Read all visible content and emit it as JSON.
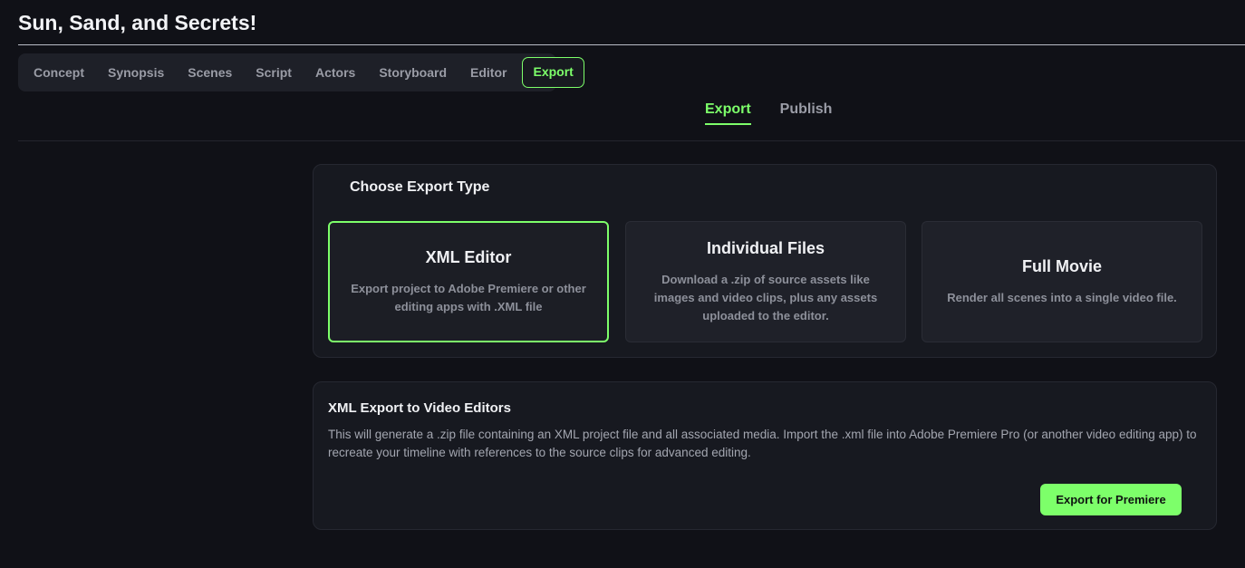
{
  "project": {
    "title": "Sun, Sand, and Secrets!"
  },
  "stepper": {
    "steps": [
      "Concept",
      "Synopsis",
      "Scenes",
      "Script",
      "Actors",
      "Storyboard",
      "Editor",
      "Export"
    ],
    "active": "Export"
  },
  "subtabs": {
    "export_label": "Export",
    "publish_label": "Publish",
    "active": "Export"
  },
  "export_type": {
    "heading": "Choose Export Type",
    "cards": [
      {
        "title": "XML Editor",
        "description": "Export project to Adobe Premiere or other editing apps with .XML file",
        "selected": true
      },
      {
        "title": "Individual Files",
        "description": "Download a .zip of source assets like images and video clips, plus any assets uploaded to the editor.",
        "selected": false
      },
      {
        "title": "Full Movie",
        "description": "Render all scenes into a single video file.",
        "selected": false
      }
    ]
  },
  "xml_export": {
    "title": "XML Export to Video Editors",
    "description": "This will generate a .zip file containing an XML project file and all associated media. Import the .xml file into Adobe Premiere Pro (or another video editing app) to recreate your timeline with references to the source clips for advanced editing.",
    "button_label": "Export for Premiere"
  },
  "colors": {
    "accent": "#7dff6a",
    "background": "#101117",
    "panel": "#171920"
  }
}
